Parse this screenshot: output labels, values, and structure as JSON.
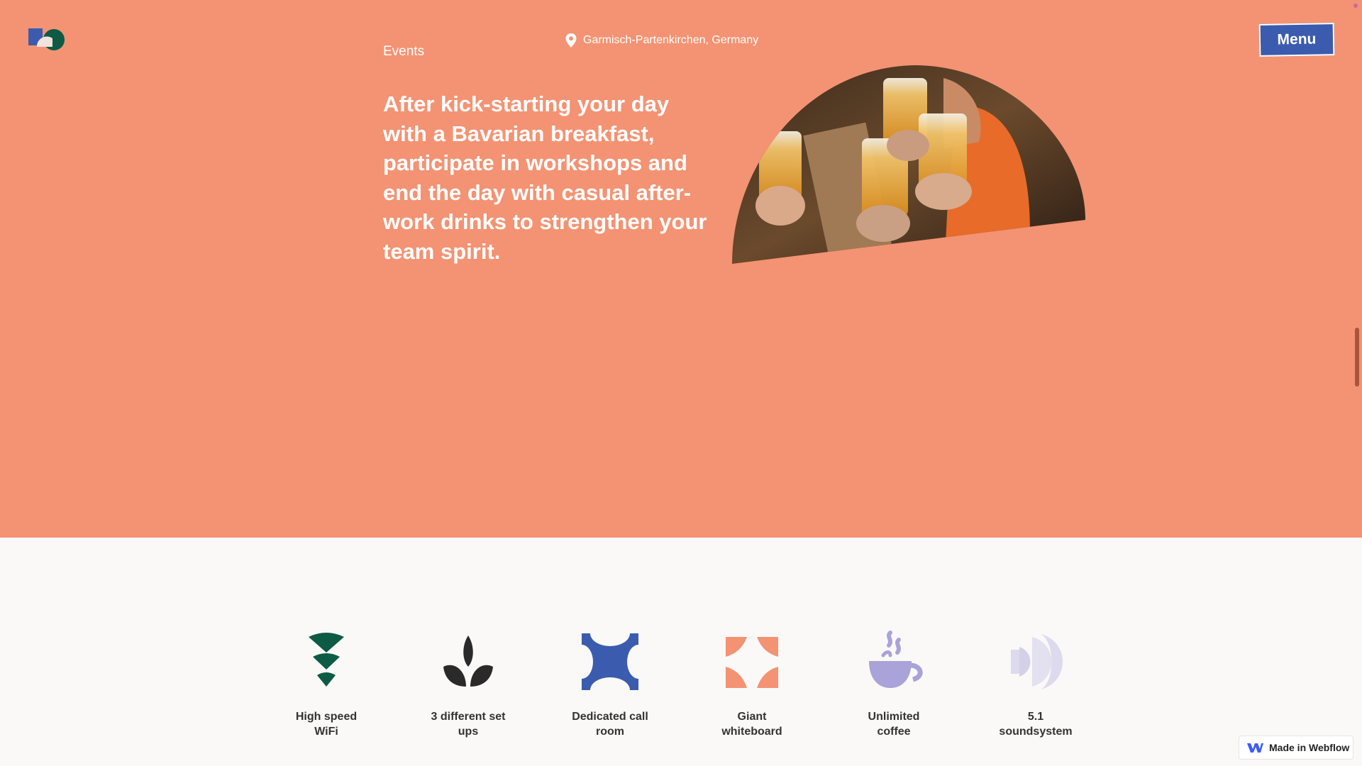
{
  "header": {
    "nav_label": "Events",
    "location": "Garmisch-Partenkirchen, Germany",
    "menu_label": "Menu"
  },
  "hero": {
    "headline": "After kick-starting your day with a Bavarian breakfast, participate in workshops and end the day with casual after-work drinks to strengthen your team spirit.",
    "background_color": "#f39373"
  },
  "features": [
    {
      "line1": "High speed",
      "line2": "WiFi",
      "icon": "wifi-icon"
    },
    {
      "line1": "3 different set",
      "line2": "ups",
      "icon": "leaf-icon"
    },
    {
      "line1": "Dedicated call",
      "line2": "room",
      "icon": "call-room-icon"
    },
    {
      "line1": "Giant",
      "line2": "whiteboard",
      "icon": "whiteboard-icon"
    },
    {
      "line1": "Unlimited",
      "line2": "coffee",
      "icon": "coffee-icon"
    },
    {
      "line1": "5.1",
      "line2": "soundsystem",
      "icon": "speaker-icon"
    }
  ],
  "badge": {
    "label": "Made in Webflow"
  },
  "colors": {
    "accent": "#f39373",
    "menu_blue": "#3b5cae",
    "green": "#0d5a45",
    "dark": "#2a2a2a",
    "lavender": "#a9a3d9",
    "light_lavender": "#dcdaec"
  }
}
